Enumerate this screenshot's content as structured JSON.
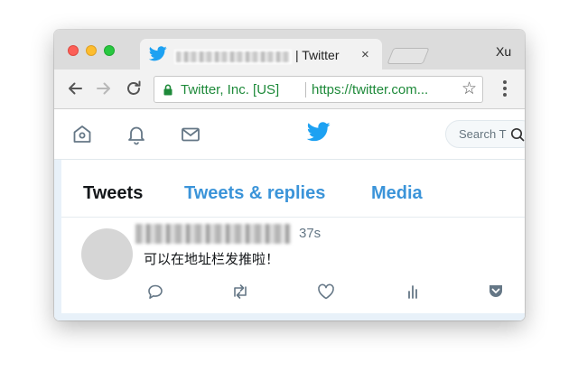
{
  "browser": {
    "tab": {
      "title": "| Twitter",
      "close_glyph": "×"
    },
    "profile_name": "Xu",
    "address_bar": {
      "organization": "Twitter, Inc. [US]",
      "url": "https://twitter.com..."
    },
    "star_glyph": "☆"
  },
  "twitter": {
    "search_placeholder": "Search T",
    "profile_tabs": [
      "Tweets",
      "Tweets & replies",
      "Media"
    ],
    "active_tab": "Tweets",
    "tweet": {
      "time": "37s",
      "text": "可以在地址栏发推啦！"
    }
  },
  "colors": {
    "twitter_blue": "#1da1f2",
    "tab_link_blue": "#3b94d9",
    "secure_green": "#1e8a3a",
    "icon_gray": "#657786"
  },
  "icons": [
    "twitter-bird-icon",
    "back-arrow-icon",
    "forward-arrow-icon",
    "reload-icon",
    "lock-icon",
    "star-icon",
    "menu-icon",
    "home-icon",
    "notifications-bell-icon",
    "messages-envelope-icon",
    "search-icon",
    "reply-icon",
    "retweet-icon",
    "like-heart-icon",
    "analytics-icon",
    "pocket-icon"
  ]
}
